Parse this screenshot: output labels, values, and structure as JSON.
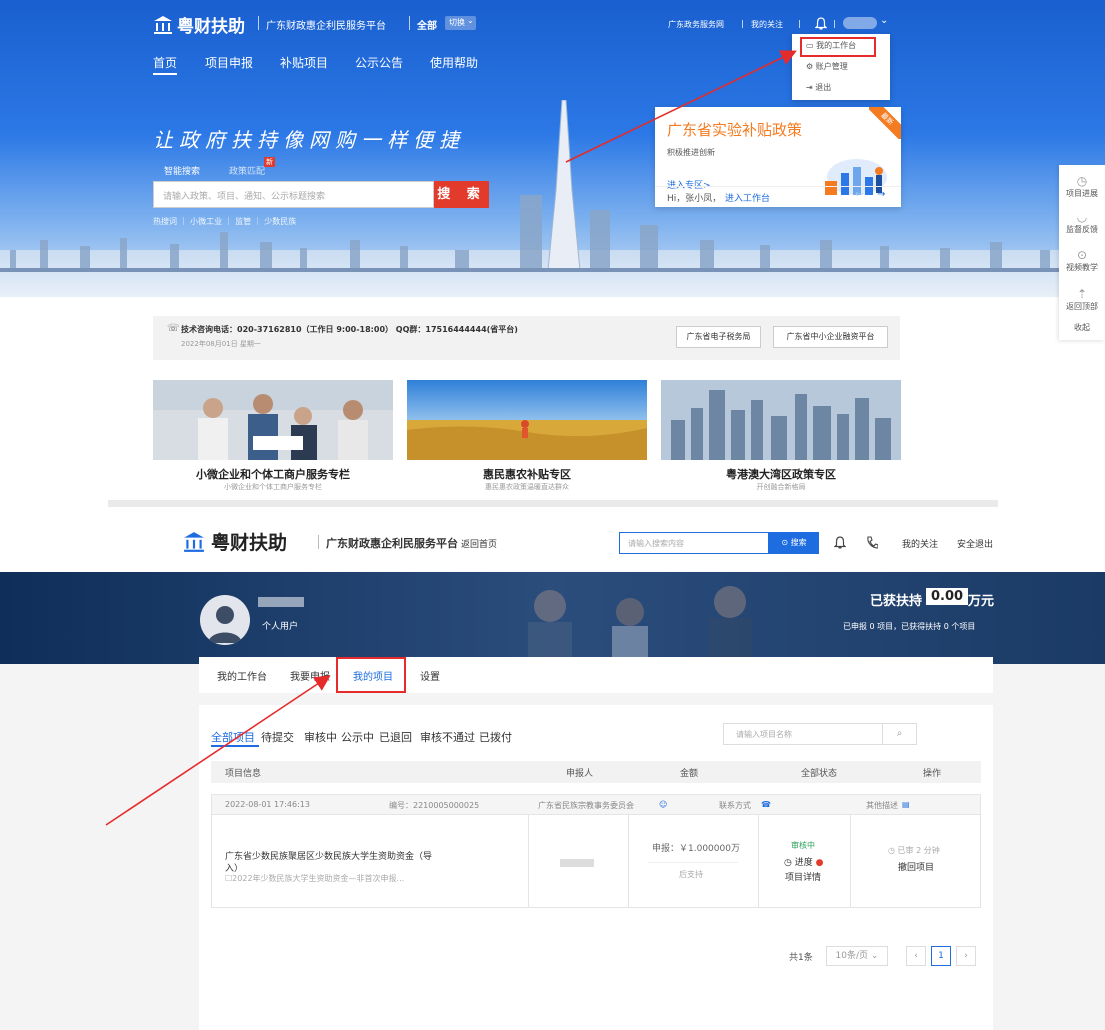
{
  "top": {
    "brand": "粤财扶助",
    "platform": "广东财政惠企利民服务平台",
    "scope": "全部",
    "switch_label": "切换",
    "gov_link": "广东政务服务网",
    "my_follow": "我的关注",
    "nav": [
      "首页",
      "项目申报",
      "补贴项目",
      "公示公告",
      "使用帮助"
    ],
    "dropdown": [
      "我的工作台",
      "账户管理",
      "退出"
    ],
    "slogan": "让政府扶持像网购一样便捷",
    "search_tabs": [
      "智能搜索",
      "政策匹配"
    ],
    "new_badge": "新",
    "search_placeholder": "请输入政策、项目、通知、公示标题搜索",
    "search_button": "搜 索",
    "hot_words": "热搜词 ｜ 小微工业 ｜ 监管 ｜ 少数民族",
    "promo": {
      "ribbon": "最新",
      "title": "广东省实验补贴政策",
      "subtitle": "积极推进创新",
      "link": "进入专区>",
      "greeting": "Hi，张小凤，",
      "enter": "进入工作台"
    },
    "side": [
      "项目进展",
      "监督反馈",
      "视频教学",
      "返回顶部",
      "收起"
    ],
    "contact": "技术咨询电话：020-37162810（工作日 9:00-18:00） QQ群：17516444444(省平台)",
    "date": "2022年08月01日 星期一",
    "platform_links": [
      "广东省电子税务局",
      "广东省中小企业融资平台"
    ],
    "cards": [
      {
        "title": "小微企业和个体工商户服务专栏",
        "sub": "小微企业和个体工商户服务专栏"
      },
      {
        "title": "惠民惠农补贴专区",
        "sub": "惠民惠农政策温暖直达群众"
      },
      {
        "title": "粤港澳大湾区政策专区",
        "sub": "开创融合新格局"
      }
    ],
    "colors": {
      "primary": "#1d6ce0",
      "accent_red": "#e23b2b",
      "orange": "#f47b20"
    }
  },
  "bottom": {
    "brand": "粤财扶助",
    "platform": "广东财政惠企利民服务平台",
    "back_home": "返回首页",
    "search_placeholder": "请输入搜索内容",
    "search_button": "搜索",
    "my_follow": "我的关注",
    "logout": "安全退出",
    "user_type": "个人用户",
    "support_label": "已获扶持",
    "support_amount": "0.00",
    "support_unit": "万元",
    "support_sub": "已申报 0 项目，已获得扶持 0 个项目",
    "tabs": [
      "我的工作台",
      "我要申报",
      "我的项目",
      "设置"
    ],
    "filters": [
      "全部项目",
      "待提交",
      "审核中",
      "公示中",
      "已退回",
      "审核不通过",
      "已拨付"
    ],
    "project_search_placeholder": "请输入项目名称",
    "columns": [
      "项目信息",
      "申报人",
      "金额",
      "全部状态",
      "操作"
    ],
    "row": {
      "time": "2022-08-01 17:46:13",
      "number": "编号：2210005000025",
      "dept": "广东省民族宗教事务委员会",
      "contact": "联系方式",
      "other": "其他描述",
      "title_line1": "广东省少数民族聚居区少数民族大学生资助资金（导",
      "title_line2": "入）",
      "subtitle": "2022年少数民族大学生资助资金—非首次申报...",
      "amount": "申报：￥1.000000万",
      "amount_sub": "后支持",
      "status": "审核中",
      "progress": "进度",
      "detail": "项目详情",
      "time_ago": "已审 2 分钟",
      "withdraw": "撤回项目"
    },
    "pager": {
      "total": "共1条",
      "per_page": "10条/页",
      "current": "1"
    }
  }
}
